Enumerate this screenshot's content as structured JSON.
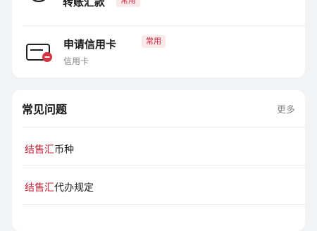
{
  "services": [
    {
      "title": "转账汇款",
      "badge": "常用",
      "icon": "transfer-icon"
    },
    {
      "title": "申请信用卡",
      "badge": "常用",
      "subtitle": "信用卡",
      "icon": "credit-card-icon"
    }
  ],
  "faq": {
    "title": "常见问题",
    "more": "更多",
    "items": [
      {
        "highlight": "结售汇",
        "rest": "币种"
      },
      {
        "highlight": "结售汇",
        "rest": "代办规定"
      }
    ]
  },
  "colors": {
    "accent": "#c9253a",
    "background": "#f2f3f5",
    "card": "#ffffff"
  }
}
